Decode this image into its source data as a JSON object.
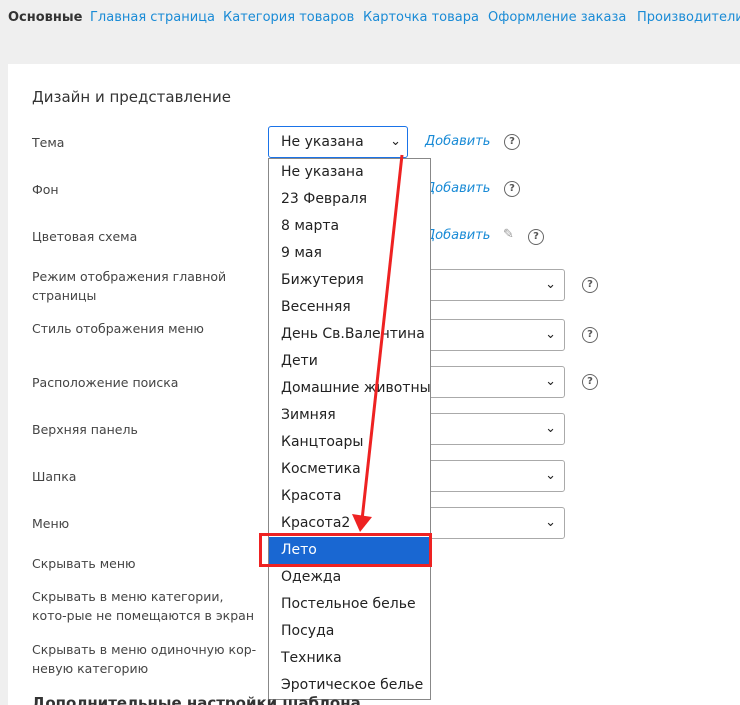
{
  "tabs": [
    "Основные",
    "Главная страница",
    "Категория товаров",
    "Карточка товара",
    "Оформление заказа",
    "Производители"
  ],
  "section_title": "Дизайн и представление",
  "section_title_2": "Дополнительные настройки шаблона",
  "fields": {
    "theme": {
      "label": "Тема",
      "value": "Не указана",
      "add": "Добавить"
    },
    "background": {
      "label": "Фон",
      "add": "Добавить"
    },
    "color_scheme": {
      "label": "Цветовая схема",
      "add": "Добавить"
    },
    "main_page_mode": {
      "label": "Режим отображения главной страницы"
    },
    "menu_style": {
      "label": "Стиль отображения меню"
    },
    "search_position": {
      "label": "Расположение поиска"
    },
    "top_panel": {
      "label": "Верхняя панель"
    },
    "header": {
      "label": "Шапка"
    },
    "menu": {
      "label": "Меню"
    },
    "hide_menu": {
      "label": "Скрывать меню"
    },
    "hide_categories": {
      "label": "Скрывать в меню категории, кото-рые не помещаются в экран"
    },
    "hide_single_root": {
      "label": "Скрывать в меню одиночную кор-невую категорию"
    }
  },
  "theme_options": [
    "Не указана",
    "23 Февраля",
    "8 марта",
    "9 мая",
    "Бижутерия",
    "Весенняя",
    "День Св.Валентина",
    "Дети",
    "Домашние животные",
    "Зимняя",
    "Канцтоары",
    "Косметика",
    "Красота",
    "Красота2",
    "Лето",
    "Одежда",
    "Постельное белье",
    "Посуда",
    "Техника",
    "Эротическое белье"
  ],
  "selected_option": "Лето",
  "icons": {
    "help": "?",
    "chevron": "⌄",
    "pencil": "✎"
  },
  "colors": {
    "accent": "#1a8bd6",
    "selected_bg": "#1967d2",
    "annotation": "#e22222"
  }
}
